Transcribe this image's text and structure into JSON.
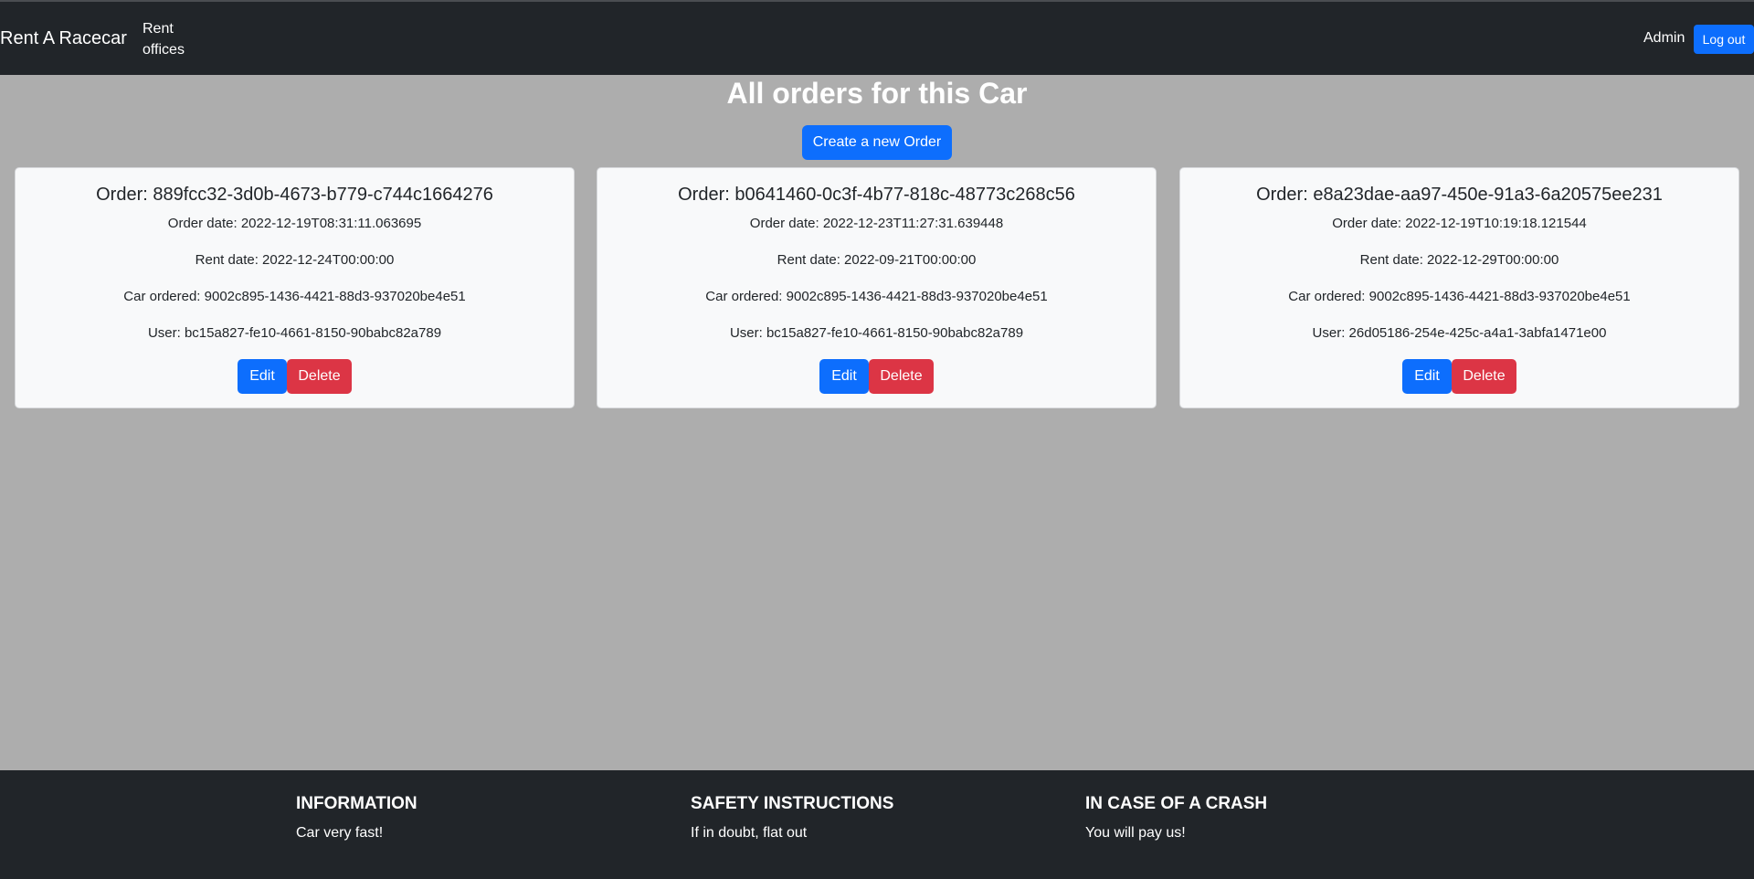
{
  "navbar": {
    "brand": "Rent A Racecar",
    "link": "Rent offices",
    "user": "Admin",
    "logout_label": "Log out"
  },
  "main": {
    "title": "All orders for this Car",
    "create_label": "Create a new Order"
  },
  "orders": [
    {
      "title": "Order: 889fcc32-3d0b-4673-b779-c744c1664276",
      "order_date": "Order date: 2022-12-19T08:31:11.063695",
      "rent_date": "Rent date: 2022-12-24T00:00:00",
      "car": "Car ordered: 9002c895-1436-4421-88d3-937020be4e51",
      "user": "User: bc15a827-fe10-4661-8150-90babc82a789",
      "edit_label": "Edit",
      "delete_label": "Delete"
    },
    {
      "title": "Order: b0641460-0c3f-4b77-818c-48773c268c56",
      "order_date": "Order date: 2022-12-23T11:27:31.639448",
      "rent_date": "Rent date: 2022-09-21T00:00:00",
      "car": "Car ordered: 9002c895-1436-4421-88d3-937020be4e51",
      "user": "User: bc15a827-fe10-4661-8150-90babc82a789",
      "edit_label": "Edit",
      "delete_label": "Delete"
    },
    {
      "title": "Order: e8a23dae-aa97-450e-91a3-6a20575ee231",
      "order_date": "Order date: 2022-12-19T10:19:18.121544",
      "rent_date": "Rent date: 2022-12-29T00:00:00",
      "car": "Car ordered: 9002c895-1436-4421-88d3-937020be4e51",
      "user": "User: 26d05186-254e-425c-a4a1-3abfa1471e00",
      "edit_label": "Edit",
      "delete_label": "Delete"
    }
  ],
  "footer": {
    "columns": [
      {
        "heading": "INFORMATION",
        "text": "Car very fast!"
      },
      {
        "heading": "SAFETY INSTRUCTIONS",
        "text": "If in doubt, flat out"
      },
      {
        "heading": "IN CASE OF A CRASH",
        "text": "You will pay us!"
      }
    ]
  },
  "colors": {
    "primary": "#0d6efd",
    "danger": "#dc3545",
    "navbar": "#212529",
    "background": "#adadad"
  }
}
